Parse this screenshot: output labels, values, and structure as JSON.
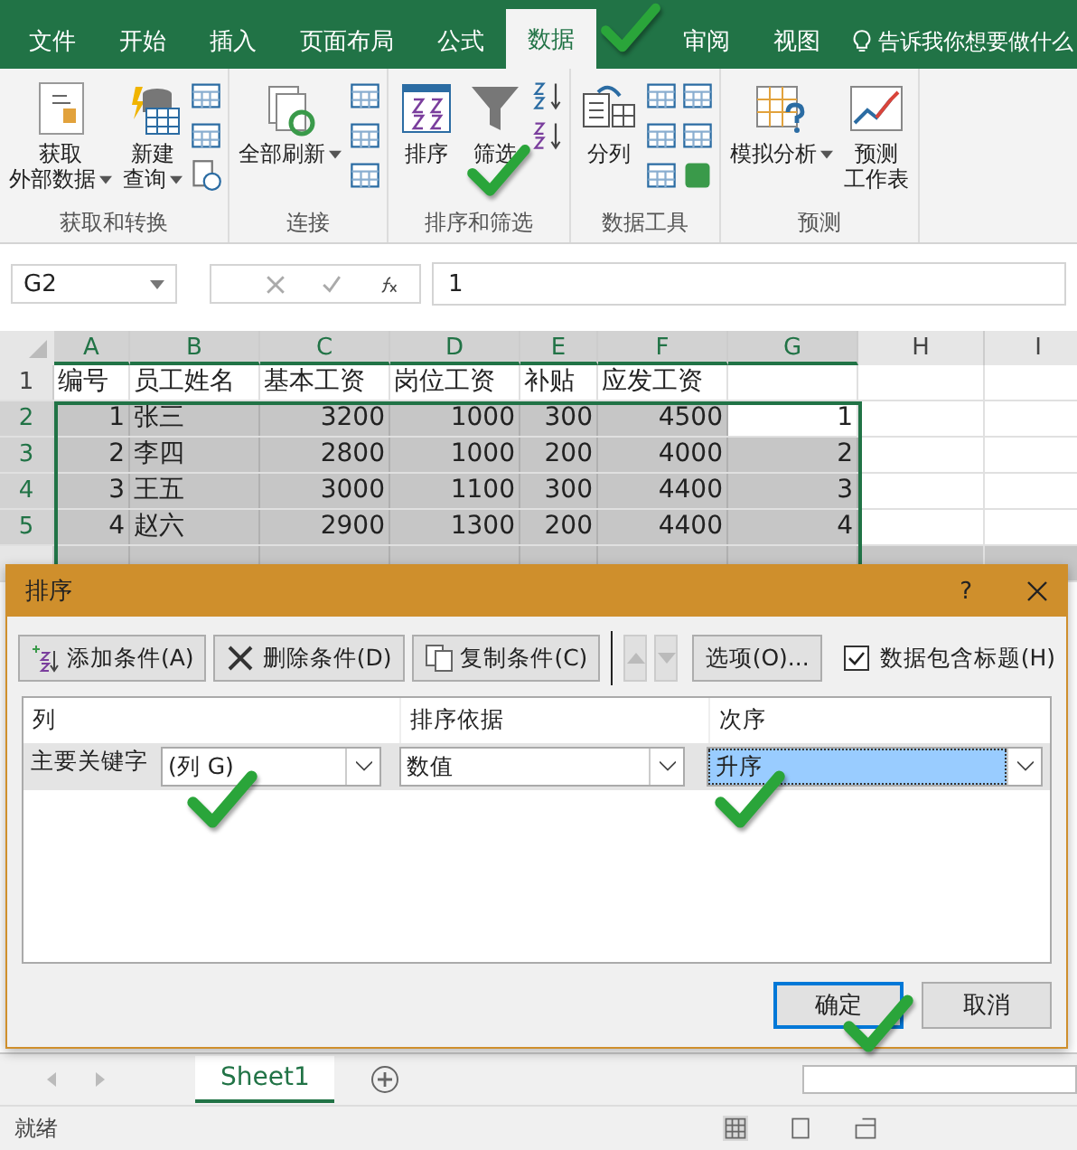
{
  "tabs": [
    {
      "label": "文件",
      "selected": false
    },
    {
      "label": "开始",
      "selected": false
    },
    {
      "label": "插入",
      "selected": false
    },
    {
      "label": "页面布局",
      "selected": false
    },
    {
      "label": "公式",
      "selected": false
    },
    {
      "label": "数据",
      "selected": true
    },
    {
      "label": "审阅",
      "selected": false
    },
    {
      "label": "视图",
      "selected": false
    }
  ],
  "tell_me": "告诉我你想要做什么",
  "ribbon": {
    "groups": [
      {
        "label": "获取和转换",
        "buttons": [
          {
            "lines": [
              "获取",
              "外部数据"
            ],
            "kind": "document",
            "dropdown": true
          },
          {
            "lines": [
              "新建",
              "查询"
            ],
            "kind": "database",
            "dropdown": true
          }
        ]
      },
      {
        "label": "连接",
        "buttons": [
          {
            "lines": [
              "全部刷新"
            ],
            "kind": "refresh",
            "dropdown": true
          }
        ]
      },
      {
        "label": "排序和筛选",
        "buttons": [
          {
            "lines": [
              "排序"
            ],
            "kind": "sort",
            "dropdown": false
          },
          {
            "lines": [
              "筛选"
            ],
            "kind": "filter",
            "dropdown": false
          }
        ]
      },
      {
        "label": "数据工具",
        "buttons": [
          {
            "lines": [
              "分列"
            ],
            "kind": "split",
            "dropdown": false
          }
        ]
      },
      {
        "label": "预测",
        "buttons": [
          {
            "lines": [
              "模拟分析"
            ],
            "kind": "whatif",
            "dropdown": true
          },
          {
            "lines": [
              "预测",
              "工作表"
            ],
            "kind": "forecast",
            "dropdown": false
          }
        ]
      }
    ]
  },
  "formula_bar": {
    "name_box": "G2",
    "value": "1"
  },
  "sheet": {
    "columns": [
      "A",
      "B",
      "C",
      "D",
      "E",
      "F",
      "G",
      "H",
      "I"
    ],
    "rows": [
      {
        "number": "1",
        "selected": false,
        "cells": [
          "编号",
          "员工姓名",
          "基本工资",
          "岗位工资",
          "补贴",
          "应发工资",
          ""
        ]
      },
      {
        "number": "2",
        "selected": true,
        "cells": [
          "1",
          "张三",
          "3200",
          "1000",
          "300",
          "4500",
          "1"
        ]
      },
      {
        "number": "3",
        "selected": true,
        "cells": [
          "2",
          "李四",
          "2800",
          "1000",
          "200",
          "4000",
          "2"
        ]
      },
      {
        "number": "4",
        "selected": true,
        "cells": [
          "3",
          "王五",
          "3000",
          "1100",
          "300",
          "4400",
          "3"
        ]
      },
      {
        "number": "5",
        "selected": true,
        "cells": [
          "4",
          "赵六",
          "2900",
          "1300",
          "200",
          "4400",
          "4"
        ]
      }
    ]
  },
  "dialog": {
    "title": "排序",
    "help": "?",
    "toolbar": [
      {
        "label": "添加条件(A)",
        "kind": "add"
      },
      {
        "label": "删除条件(D)",
        "kind": "delete"
      },
      {
        "label": "复制条件(C)",
        "kind": "copy"
      }
    ],
    "move_up_disabled": true,
    "move_down_disabled": true,
    "options_button": "选项(O)...",
    "header_checkbox": {
      "label": "数据包含标题(H)",
      "checked": true
    },
    "headers": [
      "列",
      "排序依据",
      "次序"
    ],
    "levels": [
      {
        "label": "主要关键字",
        "column": "(列 G)",
        "sort_on": "数值",
        "order": "升序",
        "order_selected": true
      }
    ],
    "ok": "确定",
    "cancel": "取消"
  },
  "sheet_tabs": [
    {
      "label": "Sheet1",
      "selected": true
    }
  ],
  "status": "就绪"
}
